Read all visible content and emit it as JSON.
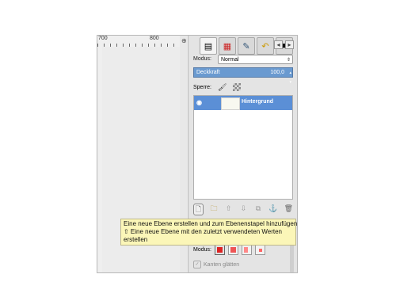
{
  "ruler": {
    "mark_left": "700",
    "mark_right": "800"
  },
  "dock": {
    "tabs": [
      {
        "name": "layers",
        "icon": "layers-icon",
        "glyph": "▤"
      },
      {
        "name": "channels",
        "icon": "channels-icon",
        "glyph": "▦"
      },
      {
        "name": "paths",
        "icon": "paths-icon",
        "glyph": "✎"
      },
      {
        "name": "undo",
        "icon": "undo-icon",
        "glyph": "↶"
      },
      {
        "name": "colormap",
        "icon": "colormap-icon",
        "glyph": "■"
      }
    ],
    "modus_label": "Modus:",
    "modus_value": "Normal",
    "opacity_label": "Deckkraft",
    "opacity_value": "100,0",
    "lock_label": "Sperre:"
  },
  "layers": [
    {
      "name": "Hintergrund",
      "selected": true
    }
  ],
  "layer_buttons": [
    {
      "name": "new-layer",
      "glyph": "🗋"
    },
    {
      "name": "new-layer-group",
      "glyph": "🗀"
    },
    {
      "name": "raise-layer",
      "glyph": "⇧"
    },
    {
      "name": "lower-layer",
      "glyph": "⇩"
    },
    {
      "name": "duplicate-layer",
      "glyph": "⧉"
    },
    {
      "name": "anchor-layer",
      "glyph": "⚓"
    },
    {
      "name": "delete-layer",
      "glyph": "🗑"
    }
  ],
  "tool_options": {
    "modus_label": "Modus:",
    "kanten_label": "Kanten glätten"
  },
  "tooltip": {
    "line1": "Eine neue Ebene erstellen und zum Ebenenstapel hinzufügen",
    "line2": "⇧  Eine neue Ebene mit den zuletzt verwendeten Werten",
    "line3": "erstellen"
  }
}
